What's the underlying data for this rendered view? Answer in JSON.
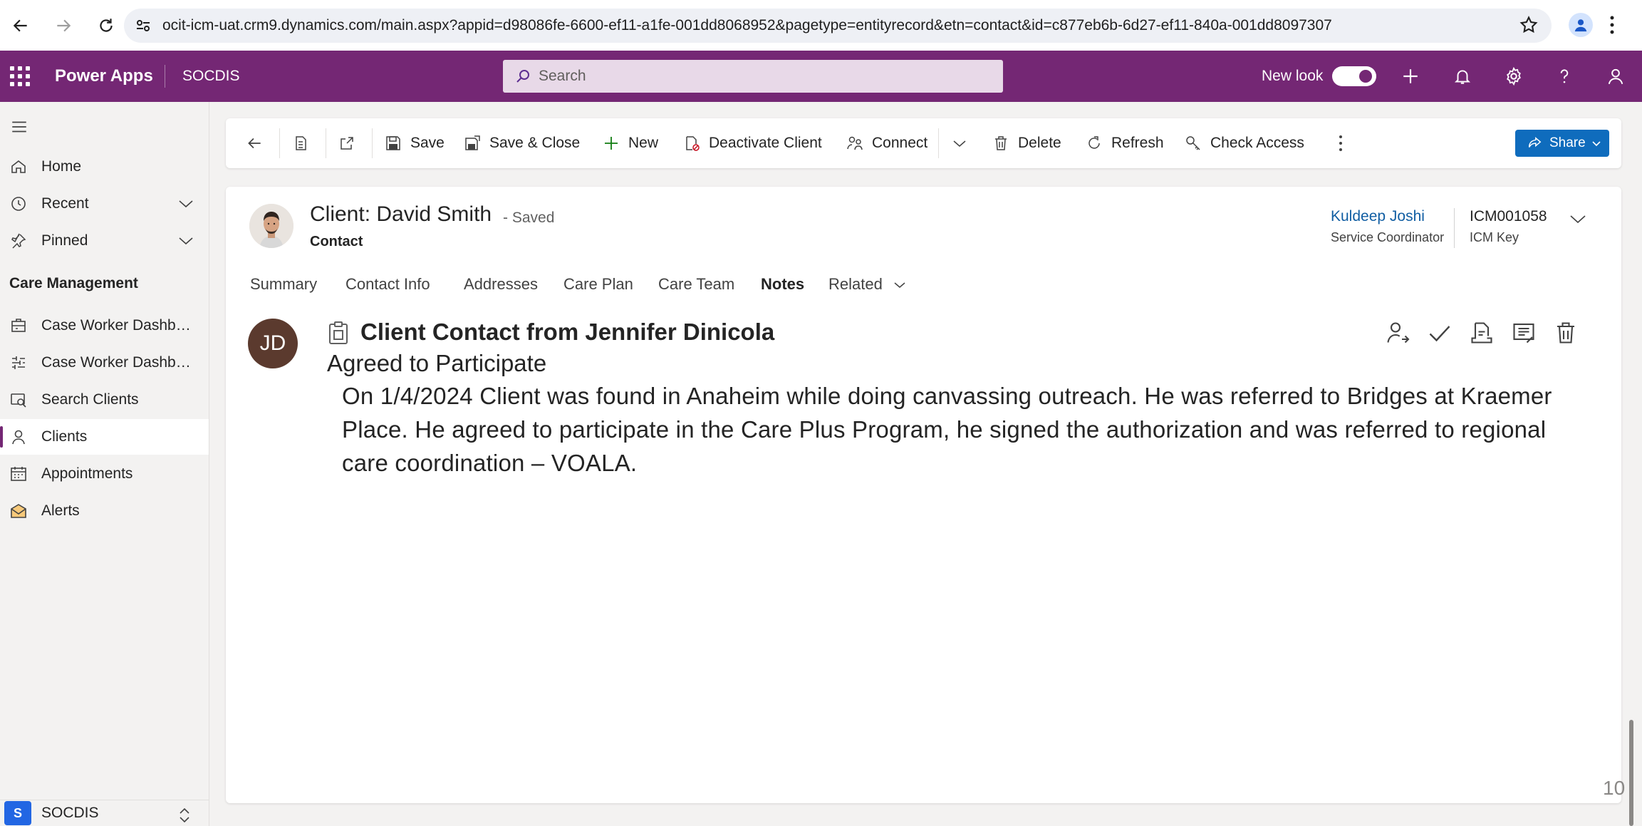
{
  "browser": {
    "url": "ocit-icm-uat.crm9.dynamics.com/main.aspx?appid=d98086fe-6600-ef11-a1fe-001dd8068952&pagetype=entityrecord&etn=contact&id=c877eb6b-6d27-ef11-840a-001dd8097307"
  },
  "appbar": {
    "brand": "Power Apps",
    "app_name": "SOCDIS",
    "search_placeholder": "Search",
    "new_look_label": "New look"
  },
  "sidebar": {
    "top_items": [
      {
        "label": "Home",
        "icon": "home-icon"
      },
      {
        "label": "Recent",
        "icon": "clock-icon"
      },
      {
        "label": "Pinned",
        "icon": "pin-icon"
      }
    ],
    "group_title": "Care Management",
    "group_items": [
      {
        "label": "Case Worker Dashbo...",
        "icon": "dashboard-icon"
      },
      {
        "label": "Case Worker Dashbo...",
        "icon": "sliders-icon"
      },
      {
        "label": "Search Clients",
        "icon": "search-clients-icon"
      },
      {
        "label": "Clients",
        "icon": "person-icon"
      },
      {
        "label": "Appointments",
        "icon": "calendar-icon"
      },
      {
        "label": "Alerts",
        "icon": "alert-mail-icon"
      }
    ],
    "area_badge": "S",
    "area_name": "SOCDIS"
  },
  "commandbar": {
    "save": "Save",
    "save_close": "Save & Close",
    "new": "New",
    "deactivate": "Deactivate Client",
    "connect": "Connect",
    "delete": "Delete",
    "refresh": "Refresh",
    "check_access": "Check Access",
    "share": "Share"
  },
  "record": {
    "title": "Client: David Smith",
    "status": "- Saved",
    "entity": "Contact",
    "owner_name": "Kuldeep Joshi",
    "owner_label": "Service Coordinator",
    "key_value": "ICM001058",
    "key_label": "ICM Key"
  },
  "tabs": [
    "Summary",
    "Contact Info",
    "Addresses",
    "Care Plan",
    "Care Team",
    "Notes",
    "Related"
  ],
  "active_tab": "Notes",
  "note": {
    "avatar_initials": "JD",
    "title": "Client Contact from Jennifer Dinicola",
    "subject": "Agreed to Participate",
    "body": "On 1/4/2024 Client was found in Anaheim while doing canvassing outreach. He was referred to Bridges at Kraemer Place. He agreed to participate in the Care Plus Program, he signed the authorization and was referred to regional care coordination – VOALA."
  },
  "page_number": "10",
  "colors": {
    "header": "#742774",
    "share_button": "#0f6cbd",
    "owner_link": "#115ea3"
  }
}
